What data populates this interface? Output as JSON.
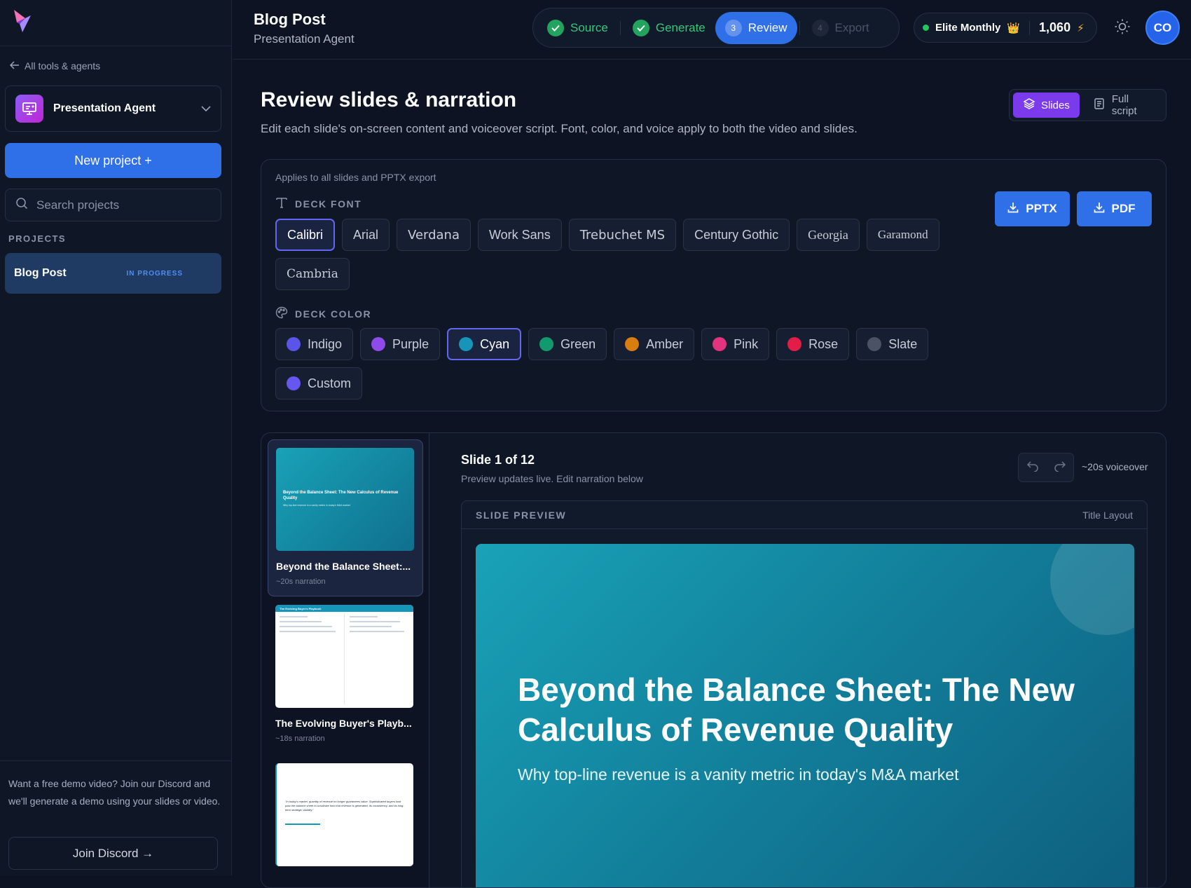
{
  "sidebar": {
    "back_label": "All tools & agents",
    "agent_name": "Presentation Agent",
    "new_project_label": "New project +",
    "search_placeholder": "Search projects",
    "projects_heading": "PROJECTS",
    "projects": [
      {
        "name": "Blog Post",
        "status": "IN PROGRESS"
      }
    ],
    "footer_text": "Want a free demo video? Join our Discord and we'll generate a demo using your slides or video.",
    "discord_label": "Join Discord →"
  },
  "header": {
    "title": "Blog Post",
    "subtitle": "Presentation Agent",
    "steps": [
      {
        "label": "Source",
        "state": "done"
      },
      {
        "label": "Generate",
        "state": "done"
      },
      {
        "label": "Review",
        "number": "3",
        "state": "active"
      },
      {
        "label": "Export",
        "number": "4",
        "state": "todo"
      }
    ],
    "plan_name": "Elite Monthly",
    "plan_icon": "👑",
    "credits": "1,060",
    "credits_icon": "⚡",
    "avatar_initials": "CO"
  },
  "main": {
    "title": "Review slides & narration",
    "description": "Edit each slide's on-screen content and voiceover script. Font, color, and voice apply to both the video and slides.",
    "view_toggle": {
      "slides_label": "Slides",
      "script_label": "Full script"
    },
    "settings": {
      "applies_text": "Applies to all slides and PPTX export",
      "font_label": "DECK FONT",
      "fonts": [
        {
          "label": "Calibri",
          "selected": true
        },
        {
          "label": "Arial"
        },
        {
          "label": "Verdana"
        },
        {
          "label": "Work Sans"
        },
        {
          "label": "Trebuchet MS"
        },
        {
          "label": "Century Gothic"
        },
        {
          "label": "Georgia"
        },
        {
          "label": "Garamond"
        },
        {
          "label": "Cambria"
        }
      ],
      "color_label": "DECK COLOR",
      "colors": [
        {
          "label": "Indigo",
          "hex": "#5b54e8"
        },
        {
          "label": "Purple",
          "hex": "#8e4bea"
        },
        {
          "label": "Cyan",
          "hex": "#1596b9",
          "selected": true
        },
        {
          "label": "Green",
          "hex": "#129a6e"
        },
        {
          "label": "Amber",
          "hex": "#d97d0e"
        },
        {
          "label": "Pink",
          "hex": "#e2337f"
        },
        {
          "label": "Rose",
          "hex": "#e11d48"
        },
        {
          "label": "Slate",
          "hex": "#4a5264"
        },
        {
          "label": "Custom",
          "hex": "#6557f0"
        }
      ],
      "export_pptx": "PPTX",
      "export_pdf": "PDF"
    },
    "thumbnails": [
      {
        "title": "Beyond the Balance Sheet:...",
        "meta": "~20s narration",
        "preview_title": "Beyond the Balance Sheet: The New Calculus of Revenue Quality",
        "preview_sub": "Why top-line revenue is a vanity metric in today's M&A market"
      },
      {
        "title": "The Evolving Buyer's Playb...",
        "meta": "~18s narration",
        "preview_title": "The Evolving Buyer's Playbook"
      },
      {
        "title": "",
        "meta": "",
        "preview_quote": "\"In today's market, quantity of revenue no longer guarantees value. Sophisticated buyers look past the balance sheet to scrutinize how that revenue is generated, its consistency, and its long-term strategic viability.\""
      }
    ],
    "slide": {
      "counter": "Slide 1 of 12",
      "hint": "Preview updates live. Edit narration below",
      "voiceover": "~20s voiceover",
      "preview_label": "SLIDE PREVIEW",
      "layout_name": "Title Layout",
      "title": "Beyond the Balance Sheet: The New Calculus of Revenue Quality",
      "subtitle": "Why top-line revenue is a vanity metric in today's M&A market"
    }
  }
}
